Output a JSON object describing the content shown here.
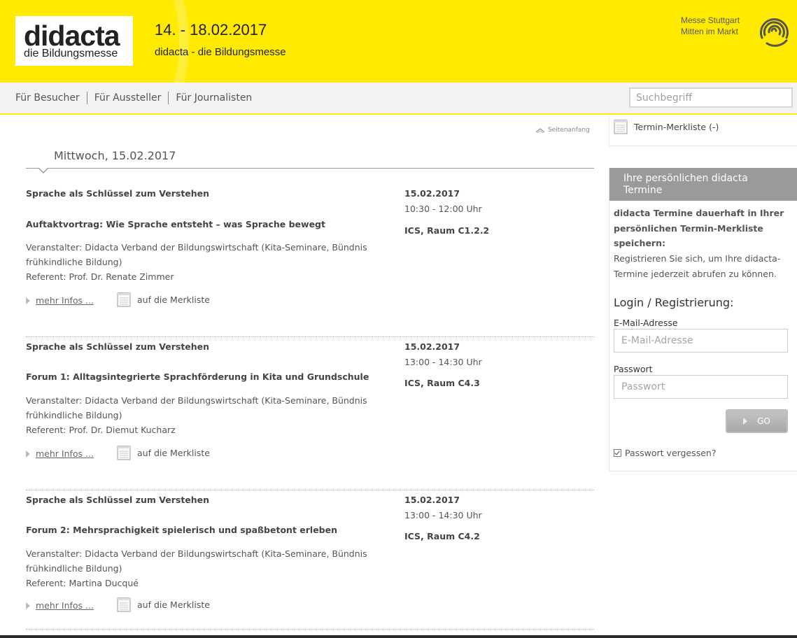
{
  "header": {
    "logo_main": "didacta",
    "logo_sub": "die Bildungsmesse",
    "date_range": "14. - 18.02.2017",
    "tagline": "didacta - die Bildungsmesse",
    "messe_line1": "Messe Stuttgart",
    "messe_line2": "Mitten im Markt",
    "messe_icon": "spiral-logo-icon",
    "accent_color": "#ffea00"
  },
  "nav": {
    "items": [
      "Für Besucher",
      "Für Aussteller",
      "Für Journalisten"
    ],
    "search_placeholder": "Suchbegriff"
  },
  "main": {
    "top_link": "Seitenanfang",
    "day_heading": "Mittwoch, 15.02.2017",
    "events": [
      {
        "series": "Sprache als Schlüssel zum Verstehen",
        "title": "Auftaktvortrag: Wie Sprache entsteht – was Sprache bewegt",
        "organizer": "Veranstalter: Didacta Verband der Bildungswirtschaft (Kita-Seminare, Bündnis frühkindliche Bildung)",
        "speaker": "Referent: Prof. Dr. Renate Zimmer",
        "date": "15.02.2017",
        "time": "10:30 - 12:00 Uhr",
        "room": "ICS, Raum C1.2.2",
        "more_label": "mehr Infos ...",
        "save_label": "auf die Merkliste"
      },
      {
        "series": "Sprache als Schlüssel zum Verstehen",
        "title": "Forum 1: Alltagsintegrierte Sprachförderung in Kita und Grundschule",
        "organizer": "Veranstalter: Didacta Verband der Bildungswirtschaft (Kita-Seminare, Bündnis frühkindliche Bildung)",
        "speaker": "Referent: Prof. Dr. Diemut Kucharz",
        "date": "15.02.2017",
        "time": "13:00 - 14:30 Uhr",
        "room": "ICS, Raum C4.3",
        "more_label": "mehr Infos ...",
        "save_label": "auf die Merkliste"
      },
      {
        "series": "Sprache als Schlüssel zum Verstehen",
        "title": "Forum 2: Mehrsprachigkeit spielerisch und spaßbetont erleben",
        "organizer": "Veranstalter: Didacta Verband der Bildungswirtschaft (Kita-Seminare, Bündnis frühkindliche Bildung)",
        "speaker": "Referent: Martina Ducqué",
        "date": "15.02.2017",
        "time": "13:00 - 14:30 Uhr",
        "room": "ICS, Raum C4.2",
        "more_label": "mehr Infos ...",
        "save_label": "auf die Merkliste"
      }
    ]
  },
  "sidebar": {
    "merkliste_label": "Termin-Merkliste (-)",
    "box_title": "Ihre persönlichen didacta Termine",
    "intro_bold": "didacta Termine dauerhaft in Ihrer persönlichen Termin-Merkliste speichern:",
    "intro": "Registrieren Sie sich, um Ihre didacta-Termine jederzeit abrufen zu können.",
    "login_heading": "Login / Registrierung:",
    "email_label": "E-Mail-Adresse",
    "email_placeholder": "E-Mail-Adresse",
    "password_label": "Passwort",
    "password_placeholder": "Passwort",
    "go_label": "GO",
    "forgot_label": "Passwort vergessen?"
  }
}
